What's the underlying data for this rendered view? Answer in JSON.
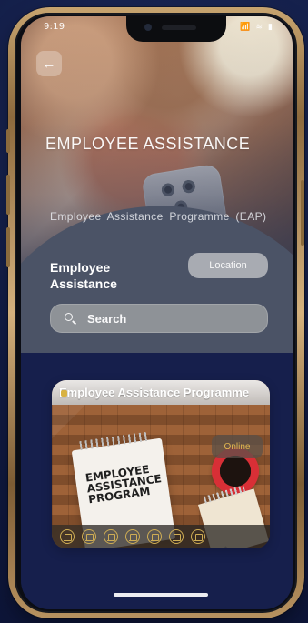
{
  "status": {
    "time": "9:19",
    "signal": "📶",
    "wifi": "≋",
    "battery": "▮"
  },
  "screen": {
    "title": "EMPLOYEE ASSISTANCE",
    "subtitle": "Employee  Assistance  Programme (EAP)",
    "section_label": "Employee Assistance",
    "location_button": "Location",
    "search_placeholder": "Search"
  },
  "card": {
    "title": "Employee Assistance Programme",
    "badge": "Online",
    "notebook_text": "EMPLOYEE\nASSISTANCE\nPROGRAM"
  },
  "colors": {
    "background": "#17204a",
    "accent_gold": "#cfad54",
    "badge_text": "#e2b650"
  },
  "icons": {
    "back": "back-arrow-icon",
    "search": "search-icon",
    "footer": [
      "footer-icon-1",
      "footer-icon-2",
      "footer-icon-3",
      "footer-icon-4",
      "footer-icon-5",
      "footer-icon-6",
      "footer-icon-7"
    ]
  }
}
